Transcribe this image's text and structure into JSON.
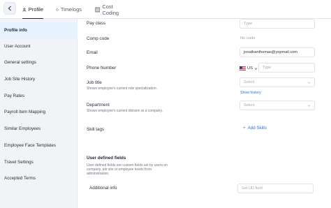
{
  "tabs": [
    {
      "label": "Profile",
      "icon": "user-icon",
      "active": true
    },
    {
      "label": "Timelogs",
      "icon": "clock-icon",
      "active": false
    },
    {
      "label": "Cost Coding",
      "icon": "grid-icon",
      "active": false
    }
  ],
  "sidebar": {
    "items": [
      {
        "label": "Profile info",
        "active": true
      },
      {
        "label": "User Account"
      },
      {
        "label": "General settings"
      },
      {
        "label": "Job Site History"
      },
      {
        "label": "Pay Rates"
      },
      {
        "label": "Payroll Item Mapping"
      },
      {
        "label": "Similar Employees"
      },
      {
        "label": "Employee Face Templates"
      },
      {
        "label": "Travel Settings"
      },
      {
        "label": "Accepted Terms"
      }
    ]
  },
  "form": {
    "pay_class": {
      "label": "Pay class",
      "placeholder": "Type"
    },
    "comp_code": {
      "label": "Comp code",
      "value": "No code"
    },
    "email": {
      "label": "Email",
      "value": "jonathanthomas@yopmail.com"
    },
    "phone": {
      "label": "Phone Number",
      "country": "US",
      "placeholder": "Type"
    },
    "job_title": {
      "label": "Job title",
      "description": "Shows employee's current role specialization.",
      "placeholder": "Select",
      "link": "Show history"
    },
    "department": {
      "label": "Department",
      "description": "Shows employee's current division at a company.",
      "placeholder": "Select"
    },
    "skill_tags": {
      "label": "Skill tags",
      "add_label": "Add Skills"
    },
    "udf": {
      "title": "User defined fields",
      "description": [
        "User defined fields are custom fields set by users on",
        "company, job site or employee levels from",
        "administration."
      ],
      "additional_info": {
        "label": "Additional info",
        "placeholder": "Set UD field"
      }
    }
  },
  "colors": {
    "accent": "#2d6ee0",
    "active_sidebar": "#e7f2ff",
    "sidebar_bg": "#f2f3f6"
  }
}
